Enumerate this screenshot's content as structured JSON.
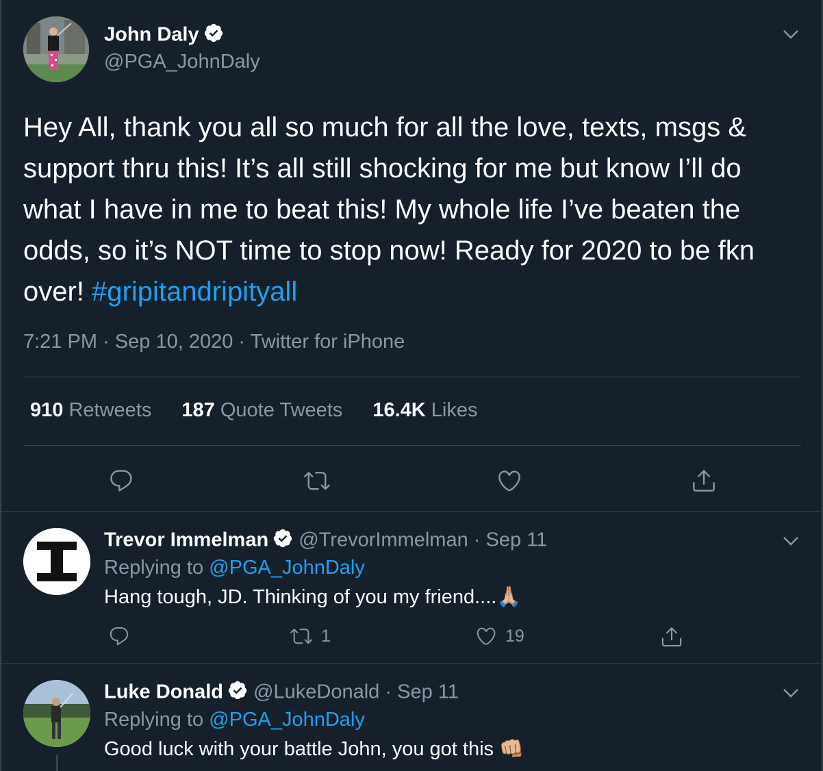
{
  "colors": {
    "background": "#15202b",
    "secondary": "#8899a6",
    "accent": "#1da1f2",
    "divider": "#38444d"
  },
  "main_tweet": {
    "name": "John Daly",
    "handle": "@PGA_JohnDaly",
    "text": "Hey All, thank you all so much for all the love, texts, msgs & support thru this! It’s all still shocking for me but know I’ll do what I have in me to beat this! My whole life I’ve beaten the odds, so it’s NOT time to stop now! Ready for 2020 to be fkn over! ",
    "hashtag": "#gripitandripityall",
    "time": "7:21 PM",
    "date": "Sep 10, 2020",
    "source": "Twitter for iPhone",
    "dot": "·",
    "stats": [
      {
        "num": "910",
        "label": "Retweets"
      },
      {
        "num": "187",
        "label": "Quote Tweets"
      },
      {
        "num": "16.4K",
        "label": "Likes"
      }
    ],
    "icons": [
      "reply-icon",
      "retweet-icon",
      "like-icon",
      "share-icon"
    ]
  },
  "replies": [
    {
      "name": "Trevor Immelman",
      "handle": "@TrevorImmelman",
      "sep": "·",
      "date": "Sep 11",
      "replying_label": "Replying to ",
      "replying_to": "@PGA_JohnDaly",
      "text": "Hang tough, JD. Thinking of you my friend....🙏🏼",
      "retweets": "1",
      "likes": "19"
    },
    {
      "name": "Luke Donald",
      "handle": "@LukeDonald",
      "sep": "·",
      "date": "Sep 11",
      "replying_label": "Replying to ",
      "replying_to": "@PGA_JohnDaly",
      "text": "Good luck with your battle John, you got this 👊🏼"
    }
  ]
}
